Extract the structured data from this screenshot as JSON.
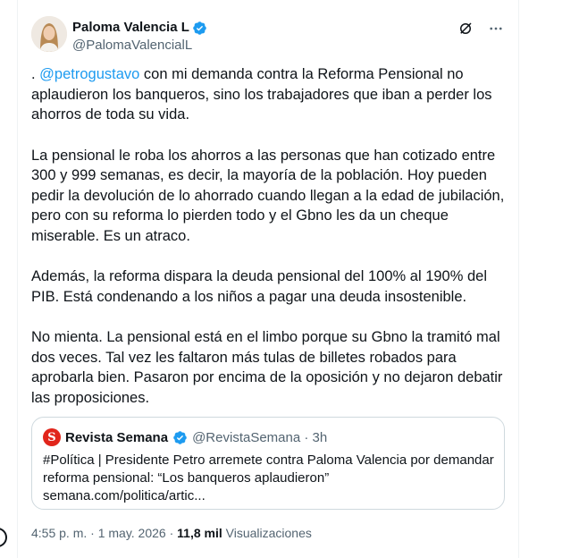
{
  "author": {
    "display_name": "Paloma Valencia L",
    "handle": "@PalomaValencialL",
    "verified": true
  },
  "header_icons": [
    "grok-icon",
    "more-options-icon"
  ],
  "tweet": {
    "p1_prefix": ". ",
    "p1_mention": "@petrogustavo",
    "p1_rest": " con mi demanda contra la Reforma Pensional no aplaudieron los banqueros, sino los trabajadores que iban a perder los ahorros de toda su vida.",
    "p2": "La pensional le roba los ahorros a las personas que han cotizado entre 300 y 999 semanas, es decir, la mayoría de la población. Hoy pueden pedir la devolución de lo ahorrado cuando llegan a la edad de jubilación, pero con su reforma lo pierden todo y el Gbno les da un cheque miserable. Es un atraco.",
    "p3": "Además, la reforma dispara la deuda pensional del 100% al 190% del PIB. Está condenando a los niños a pagar una deuda insostenible.",
    "p4": "No mienta. La pensional está en el limbo porque su Gbno la tramitó mal dos veces. Tal vez les faltaron más tulas de billetes robados para aprobarla bien. Pasaron por encima de la oposición y no dejaron debatir las proposiciones."
  },
  "quote": {
    "logo_letter": "S",
    "name": "Revista Semana",
    "handle_time": "@RevistaSemana · 3h",
    "text": "#Política | Presidente Petro arremete contra Paloma Valencia por demandar reforma pensional: “Los banqueros aplaudieron”",
    "link": "semana.com/politica/artic..."
  },
  "meta": {
    "timestamp": "4:55 p. m. · 1 may. 2026 · ",
    "views_count": "11,8 mil",
    "views_label": " Visualizaciones"
  },
  "colors": {
    "link": "#1d9bf0",
    "verified": "#1d9bf0",
    "semana_red": "#e1251b",
    "secondary_text": "#536471"
  }
}
